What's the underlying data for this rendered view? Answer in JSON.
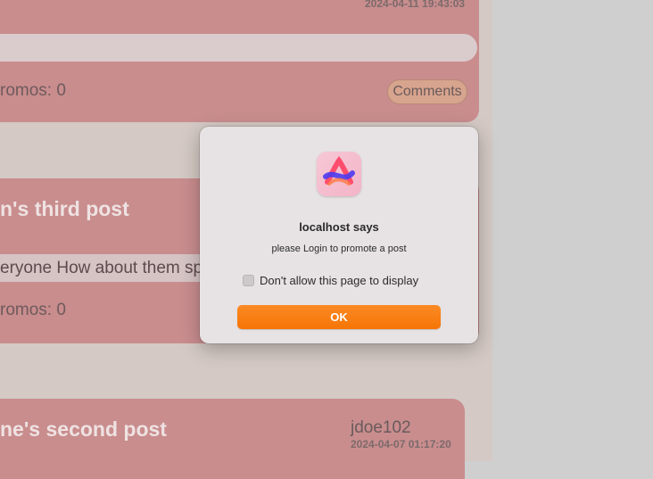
{
  "posts": [
    {
      "timestamp": "2024-04-11 19:43:03",
      "promos": "romos: 0",
      "comments_label": "Comments"
    },
    {
      "title": "n's third post",
      "body": "eryone How about them sp",
      "promos": "romos: 0"
    },
    {
      "title": "ne's second post",
      "author": "jdoe102",
      "timestamp": "2024-04-07 01:17:20"
    }
  ],
  "dialog": {
    "title": "localhost says",
    "message": "please Login to promote a post",
    "checkbox_label": "Don't allow this page to display",
    "ok_label": "OK",
    "app_icon": "arc-browser-icon"
  },
  "colors": {
    "card": "#c98d8e",
    "ok_button": "#f67505",
    "dialog_bg": "#e7e3e4"
  }
}
